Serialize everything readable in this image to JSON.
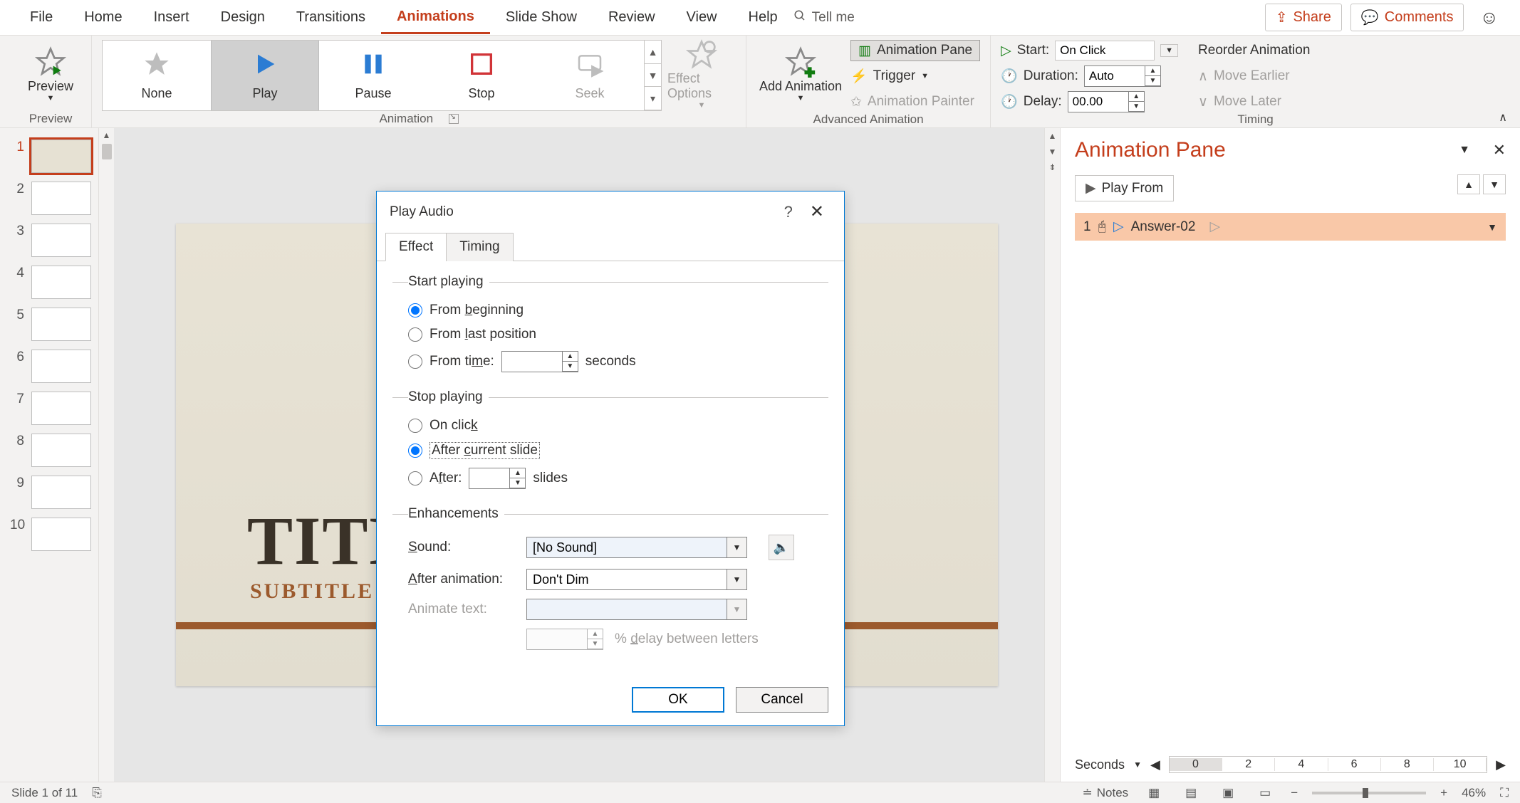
{
  "menubar": {
    "items": [
      "File",
      "Home",
      "Insert",
      "Design",
      "Transitions",
      "Animations",
      "Slide Show",
      "Review",
      "View",
      "Help"
    ],
    "active_index": 5,
    "tell_me": "Tell me",
    "share": "Share",
    "comments": "Comments"
  },
  "ribbon": {
    "preview": {
      "label": "Preview",
      "group": "Preview"
    },
    "animation": {
      "group": "Animation",
      "items": [
        "None",
        "Play",
        "Pause",
        "Stop",
        "Seek"
      ],
      "selected_index": 1,
      "effect_options": "Effect Options"
    },
    "advanced": {
      "group": "Advanced Animation",
      "add_animation": "Add Animation",
      "animation_pane": "Animation Pane",
      "trigger": "Trigger",
      "animation_painter": "Animation Painter"
    },
    "timing": {
      "group": "Timing",
      "start_label": "Start:",
      "start_value": "On Click",
      "duration_label": "Duration:",
      "duration_value": "Auto",
      "delay_label": "Delay:",
      "delay_value": "00.00",
      "reorder": "Reorder Animation",
      "move_earlier": "Move Earlier",
      "move_later": "Move Later"
    }
  },
  "slides": {
    "numbers": [
      "1",
      "2",
      "3",
      "4",
      "5",
      "6",
      "7",
      "8",
      "9",
      "10"
    ],
    "active_index": 0,
    "canvas": {
      "title": "TITL",
      "subtitle": "SUBTITLE"
    }
  },
  "animation_pane": {
    "title": "Animation Pane",
    "play_from": "Play From",
    "item_index": "1",
    "item_name": "Answer-02",
    "seconds_label": "Seconds",
    "ticks": [
      "0",
      "2",
      "4",
      "6",
      "8",
      "10"
    ]
  },
  "dialog": {
    "title": "Play Audio",
    "tabs": [
      "Effect",
      "Timing"
    ],
    "active_tab": 0,
    "start_playing": {
      "legend": "Start playing",
      "from_beginning": "From beginning",
      "from_last_position": "From last position",
      "from_time": "From time:",
      "seconds": "seconds",
      "selected": "from_beginning"
    },
    "stop_playing": {
      "legend": "Stop playing",
      "on_click": "On click",
      "after_current_slide": "After current slide",
      "after": "After:",
      "slides": "slides",
      "selected": "after_current_slide"
    },
    "enhancements": {
      "legend": "Enhancements",
      "sound_label": "Sound:",
      "sound_value": "[No Sound]",
      "after_animation_label": "After animation:",
      "after_animation_value": "Don't Dim",
      "animate_text_label": "Animate text:",
      "animate_text_value": "",
      "delay_letters": "% delay between letters"
    },
    "ok": "OK",
    "cancel": "Cancel"
  },
  "statusbar": {
    "slide_info": "Slide 1 of 11",
    "notes": "Notes",
    "zoom": "46%"
  }
}
